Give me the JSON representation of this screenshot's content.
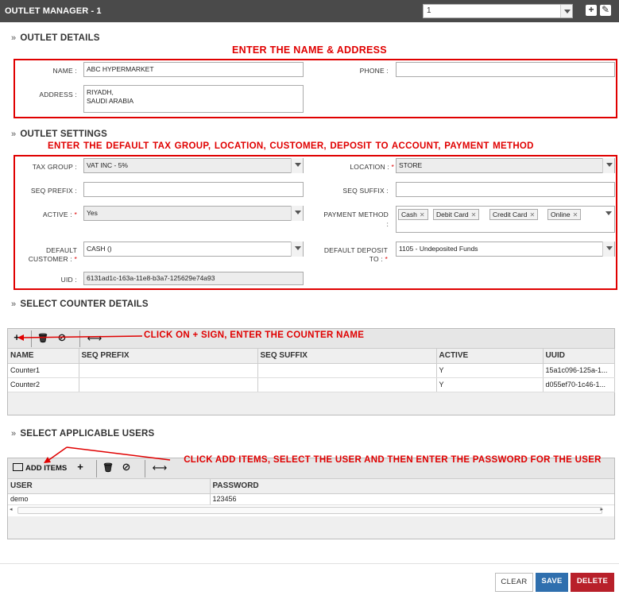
{
  "window": {
    "title": "OUTLET MANAGER - 1",
    "record_select": "1",
    "icons": [
      "add-box-icon",
      "edit-box-icon"
    ]
  },
  "outlet_details": {
    "heading": "OUTLET DETAILS",
    "annotation": "ENTER THE NAME & ADDRESS",
    "name_label": "NAME :",
    "name_value": "ABC HYPERMARKET",
    "address_label": "ADDRESS :",
    "address_value": "RIYADH,\nSAUDI ARABIA",
    "phone_label": "PHONE :",
    "phone_value": ""
  },
  "outlet_settings": {
    "heading": "OUTLET SETTINGS",
    "annotation": "ENTER THE DEFAULT TAX GROUP,  LOCATION, CUSTOMER, DEPOSIT TO ACCOUNT,   PAYMENT METHOD",
    "tax_group_label": "TAX GROUP :",
    "tax_group_value": "VAT INC - 5%",
    "location_label": "LOCATION :",
    "location_value": "STORE",
    "seq_prefix_label": "SEQ PREFIX :",
    "seq_prefix_value": "",
    "seq_suffix_label": "SEQ SUFFIX :",
    "seq_suffix_value": "",
    "active_label": "ACTIVE :",
    "active_value": "Yes",
    "payment_method_label": "PAYMENT METHOD",
    "payment_method_colon": ":",
    "payment_methods": [
      "Cash",
      "Debit Card",
      "Credit Card",
      "Online"
    ],
    "default_customer_label_1": "DEFAULT",
    "default_customer_label_2": "CUSTOMER :",
    "default_customer_value": "CASH ()",
    "default_deposit_label_1": "DEFAULT DEPOSIT",
    "default_deposit_label_2": "TO :",
    "default_deposit_value": "1105 - Undeposited Funds",
    "uid_label": "UID :",
    "uid_value": "6131ad1c-163a-11e8-b3a7-125629e74a93",
    "required_mark": "*"
  },
  "counters": {
    "heading": "SELECT COUNTER DETAILS",
    "annotation": "CLICK ON + SIGN, ENTER THE COUNTER NAME",
    "columns": [
      "NAME",
      "SEQ PREFIX",
      "SEQ SUFFIX",
      "ACTIVE",
      "UUID"
    ],
    "rows": [
      [
        "Counter1",
        "",
        "",
        "Y",
        "15a1c096-125a-1..."
      ],
      [
        "Counter2",
        "",
        "",
        "Y",
        "d055ef70-1c46-1..."
      ]
    ]
  },
  "users": {
    "heading": "SELECT APPLICABLE USERS",
    "annotation": "CLICK ADD ITEMS, SELECT THE USER AND THEN ENTER THE PASSWORD FOR THE USER",
    "add_items_label": "ADD ITEMS",
    "columns": [
      "USER",
      "PASSWORD"
    ],
    "rows": [
      [
        "demo",
        "123456"
      ]
    ]
  },
  "footer": {
    "clear_label": "CLEAR",
    "save_label": "SAVE",
    "delete_label": "DELETE"
  },
  "colors": {
    "titlebar": "#4a4a4a",
    "annotation_red": "#e00000",
    "save_blue": "#2f6fae",
    "delete_red": "#b8202a"
  }
}
